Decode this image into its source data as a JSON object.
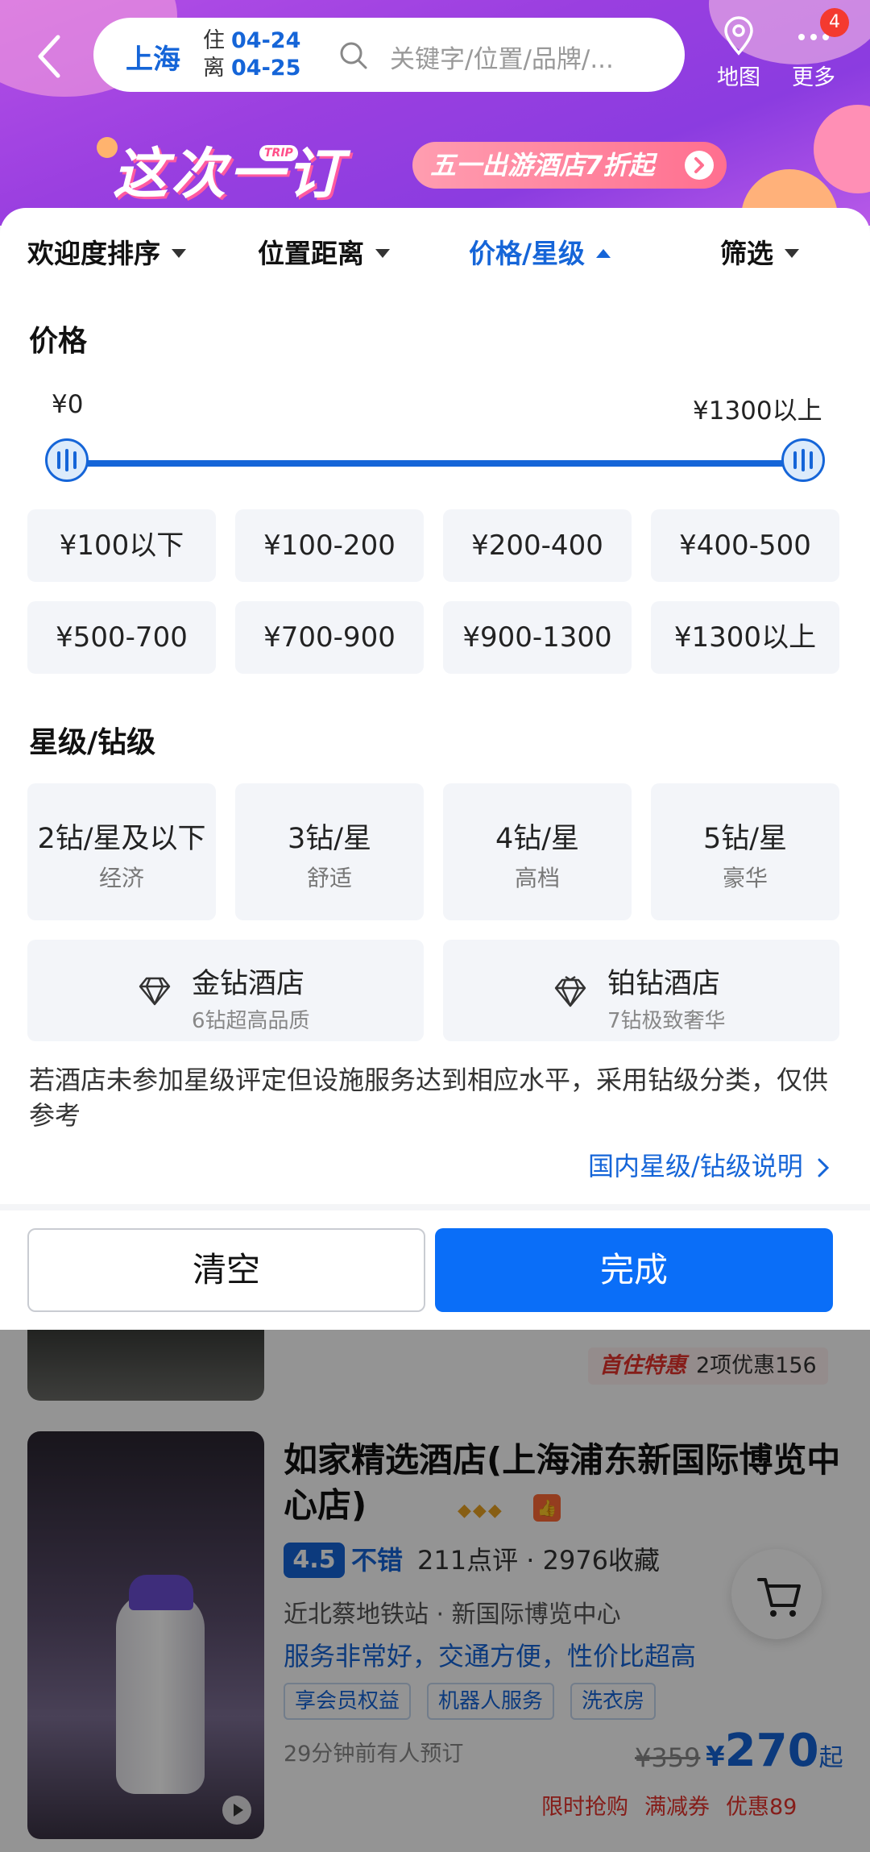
{
  "header": {
    "city": "上海",
    "checkin_label": "住",
    "checkin_date": "04-24",
    "checkout_label": "离",
    "checkout_date": "04-25",
    "search_placeholder": "关键字/位置/品牌/...",
    "map_label": "地图",
    "more_label": "更多",
    "more_badge": "4"
  },
  "promo": {
    "brand_text": "这次一订",
    "brand_tag": "TRIP",
    "pill_text": "五一出游酒店7折起"
  },
  "tabs": [
    {
      "label": "欢迎度排序",
      "active": false
    },
    {
      "label": "位置距离",
      "active": false
    },
    {
      "label": "价格/星级",
      "active": true
    },
    {
      "label": "筛选",
      "active": false
    }
  ],
  "price": {
    "title": "价格",
    "min_label": "¥0",
    "max_label": "¥1300以上",
    "options": [
      "¥100以下",
      "¥100-200",
      "¥200-400",
      "¥400-500",
      "¥500-700",
      "¥700-900",
      "¥900-1300",
      "¥1300以上"
    ]
  },
  "star": {
    "title": "星级/钻级",
    "options": [
      {
        "label": "2钻/星及以下",
        "sub": "经济"
      },
      {
        "label": "3钻/星",
        "sub": "舒适"
      },
      {
        "label": "4钻/星",
        "sub": "高档"
      },
      {
        "label": "5钻/星",
        "sub": "豪华"
      }
    ],
    "special": [
      {
        "label": "金钻酒店",
        "sub": "6钻超高品质"
      },
      {
        "label": "铂钻酒店",
        "sub": "7钻极致奢华"
      }
    ],
    "note": "若酒店未参加星级评定但设施服务达到相应水平，采用钻级分类，仅供参考",
    "link": "国内星级/钻级说明"
  },
  "actions": {
    "clear": "清空",
    "done": "完成"
  },
  "prev_card": {
    "promo_tag": "首住特惠",
    "promo_text": "2项优惠156"
  },
  "hotel": {
    "name": "如家精选酒店(上海浦东新国际博览中心店)",
    "diamonds": "◆◆◆",
    "thumb": "👍",
    "score": "4.5",
    "score_label": "不错",
    "reviews": "211点评 · 2976收藏",
    "location": "近北蔡地铁站 · 新国际博览中心",
    "highlight": "服务非常好，交通方便，性价比超高",
    "tags": [
      "享会员权益",
      "机器人服务",
      "洗衣房"
    ],
    "recent_booking": "29分钟前有人预订",
    "old_price": "¥359",
    "currency": "¥",
    "price": "270",
    "price_suffix": "起",
    "deals": [
      "限时抢购",
      "满减券",
      "优惠89"
    ]
  },
  "colors": {
    "accent": "#1565d8",
    "primary_button": "#0a6ef8",
    "header_purple": "#9a3fe0",
    "deal_red": "#e6322c"
  }
}
